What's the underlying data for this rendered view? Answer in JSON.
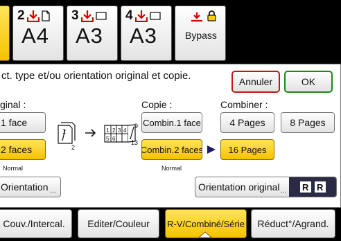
{
  "trays": [
    {
      "number": "2",
      "size": "A4"
    },
    {
      "number": "3",
      "size": "A3"
    },
    {
      "number": "4",
      "size": "A3"
    }
  ],
  "bypass": {
    "label": "Bypass"
  },
  "panel": {
    "instruction": "ct. type et/ou orientation original et copie.",
    "cancel_label": "Annuler",
    "ok_label": "OK",
    "original_header": "ginal :",
    "copy_header": "Copie :",
    "combine_header": "Combiner :",
    "original_options": [
      "1 face",
      "2 faces"
    ],
    "copy_options": [
      "Combin.1 face",
      "Combin.2 faces"
    ],
    "combine_options": [
      "4 Pages",
      "8 Pages",
      "16 Pages"
    ],
    "normal_label_1": "Normal",
    "normal_label_2": "Normal",
    "orientation_left_label": "Orientation",
    "orientation_original_label": "Orientation original",
    "diagram_labels": [
      "2",
      "9",
      "13"
    ]
  },
  "tabs": [
    {
      "label": "Couv./Intercal."
    },
    {
      "label": "Editer/Couleur"
    },
    {
      "label": "R-V/Combiné/Série"
    },
    {
      "label": "Réduct°/Agrand."
    }
  ],
  "colors": {
    "selected": "#f6c200",
    "tray_icon": "#d00000",
    "cancel_border": "#c21818",
    "ok_border": "#1a8a1a",
    "screen_bg": "#000000"
  }
}
